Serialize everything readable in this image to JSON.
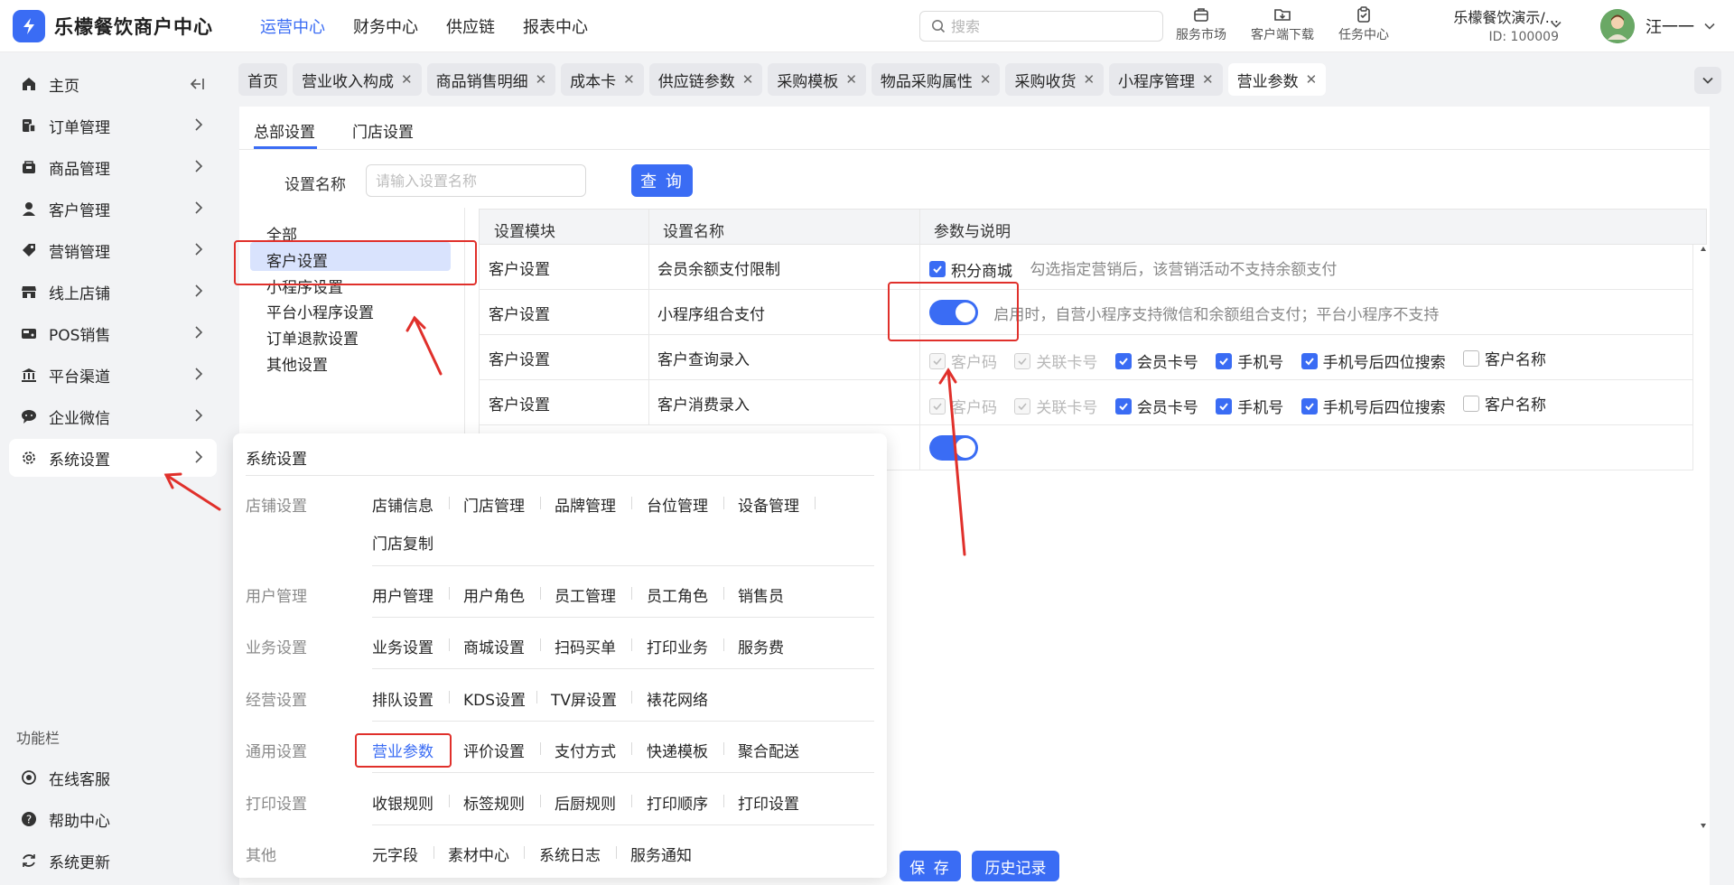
{
  "app": {
    "title": "乐檬餐饮商户中心"
  },
  "topnav": [
    {
      "label": "运营中心",
      "active": true
    },
    {
      "label": "财务中心",
      "active": false
    },
    {
      "label": "供应链",
      "active": false
    },
    {
      "label": "报表中心",
      "active": false
    }
  ],
  "search": {
    "placeholder": "搜索"
  },
  "tools": [
    {
      "label": "服务市场",
      "icon": "briefcase-icon"
    },
    {
      "label": "客户端下载",
      "icon": "download-folder-icon"
    },
    {
      "label": "任务中心",
      "icon": "clipboard-check-icon"
    }
  ],
  "tenant": {
    "name": "乐檬餐饮演示/...",
    "id": "ID: 100009"
  },
  "user": {
    "name": "汪一一"
  },
  "sidebar": {
    "items": [
      {
        "label": "主页",
        "icon": "home-icon"
      },
      {
        "label": "订单管理",
        "icon": "order-icon"
      },
      {
        "label": "商品管理",
        "icon": "goods-icon"
      },
      {
        "label": "客户管理",
        "icon": "user-icon"
      },
      {
        "label": "营销管理",
        "icon": "tag-icon"
      },
      {
        "label": "线上店铺",
        "icon": "shop-icon"
      },
      {
        "label": "POS销售",
        "icon": "pos-icon"
      },
      {
        "label": "平台渠道",
        "icon": "bank-icon"
      },
      {
        "label": "企业微信",
        "icon": "chat-icon"
      },
      {
        "label": "系统设置",
        "icon": "gear-icon"
      }
    ],
    "section_title": "功能栏",
    "bottom": [
      {
        "label": "在线客服",
        "icon": "headset-icon"
      },
      {
        "label": "帮助中心",
        "icon": "help-icon"
      },
      {
        "label": "系统更新",
        "icon": "refresh-icon"
      }
    ]
  },
  "tabs": [
    {
      "label": "首页",
      "closable": false
    },
    {
      "label": "营业收入构成",
      "closable": true
    },
    {
      "label": "商品销售明细",
      "closable": true
    },
    {
      "label": "成本卡",
      "closable": true
    },
    {
      "label": "供应链参数",
      "closable": true
    },
    {
      "label": "采购模板",
      "closable": true
    },
    {
      "label": "物品采购属性",
      "closable": true
    },
    {
      "label": "采购收货",
      "closable": true
    },
    {
      "label": "小程序管理",
      "closable": true
    },
    {
      "label": "营业参数",
      "closable": true,
      "active": true
    }
  ],
  "subtabs": [
    "总部设置",
    "门店设置"
  ],
  "filter": {
    "label": "设置名称",
    "placeholder": "请输入设置名称",
    "query": "查 询"
  },
  "categories": [
    "全部",
    "客户设置",
    "小程序设置",
    "平台小程序设置",
    "订单退款设置",
    "其他设置"
  ],
  "table": {
    "headers": [
      "设置模块",
      "设置名称",
      "参数与说明"
    ],
    "rows": [
      {
        "module": "客户设置",
        "name": "会员余额支付限制",
        "check": "积分商城",
        "desc": "勾选指定营销后，该营销活动不支持余额支付"
      },
      {
        "module": "客户设置",
        "name": "小程序组合支付",
        "desc": "启用时，自营小程序支持微信和余额组合支付；平台小程序不支持"
      },
      {
        "module": "客户设置",
        "name": "客户查询录入",
        "opts": [
          "客户码",
          "关联卡号",
          "会员卡号",
          "手机号",
          "手机号后四位搜索",
          "客户名称"
        ]
      },
      {
        "module": "客户设置",
        "name": "客户消费录入",
        "opts": [
          "客户码",
          "关联卡号",
          "会员卡号",
          "手机号",
          "手机号后四位搜索",
          "客户名称"
        ]
      }
    ]
  },
  "footer": {
    "save": "保 存",
    "history": "历史记录"
  },
  "mega": {
    "title": "系统设置",
    "groups": [
      {
        "name": "店铺设置",
        "links": [
          "店铺信息",
          "门店管理",
          "品牌管理",
          "台位管理",
          "设备管理",
          "门店复制"
        ]
      },
      {
        "name": "用户管理",
        "links": [
          "用户管理",
          "用户角色",
          "员工管理",
          "员工角色",
          "销售员"
        ]
      },
      {
        "name": "业务设置",
        "links": [
          "业务设置",
          "商城设置",
          "扫码买单",
          "打印业务",
          "服务费"
        ]
      },
      {
        "name": "经营设置",
        "links": [
          "排队设置",
          "KDS设置",
          "TV屏设置",
          "裱花网络"
        ]
      },
      {
        "name": "通用设置",
        "links": [
          "营业参数",
          "评价设置",
          "支付方式",
          "快递模板",
          "聚合配送"
        ]
      },
      {
        "name": "打印设置",
        "links": [
          "收银规则",
          "标签规则",
          "后厨规则",
          "打印顺序",
          "打印设置"
        ]
      },
      {
        "name": "其他",
        "links": [
          "元字段",
          "素材中心",
          "系统日志",
          "服务通知"
        ]
      }
    ]
  },
  "colors": {
    "accent": "#3a6cf4",
    "annotation": "#e0302b"
  }
}
